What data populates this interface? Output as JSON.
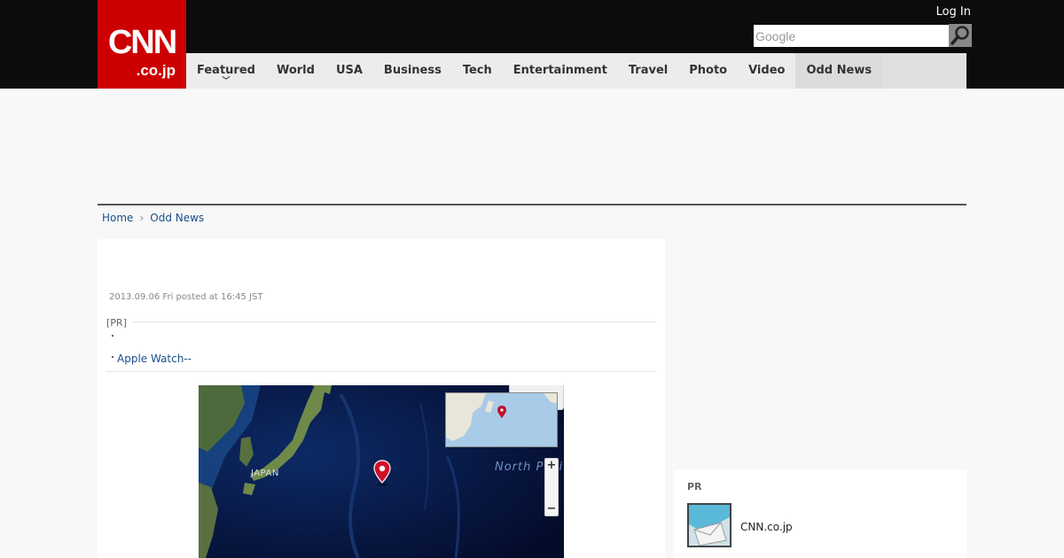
{
  "header": {
    "logo_main": "CNN",
    "logo_sub": ".co.jp",
    "login_label": "Log In",
    "search_placeholder": "Google",
    "colors": {
      "brand_red": "#cc0000",
      "bar_black": "#0c0c0c",
      "nav_bg": "#ececec"
    }
  },
  "nav": {
    "items": [
      {
        "label": "Featured",
        "has_dropdown": true
      },
      {
        "label": "World"
      },
      {
        "label": "USA"
      },
      {
        "label": "Business"
      },
      {
        "label": "Tech"
      },
      {
        "label": "Entertainment"
      },
      {
        "label": "Travel"
      },
      {
        "label": "Photo"
      },
      {
        "label": "Video"
      },
      {
        "label": "Odd News",
        "active": true
      }
    ],
    "dropdown_icon": "chevron-down-icon"
  },
  "breadcrumb": {
    "home": "Home",
    "separator_icon": "chevron-right-icon",
    "current": "Odd News"
  },
  "article": {
    "posted": "2013.09.06 Fri posted at 16:45 JST",
    "pr_label": "[PR]",
    "pr_links": [
      {
        "bullet": "・",
        "text": ""
      },
      {
        "bullet": "・",
        "text": "Apple Watch--"
      }
    ],
    "map": {
      "label_land": "JAPAN",
      "label_ocean": "North Pacific O",
      "zoom_in": "+",
      "zoom_out": "−",
      "marker_color": "#d0102a"
    }
  },
  "sidebar_pr": {
    "title": "PR",
    "items": [
      {
        "text": "CNN.co.jp"
      }
    ]
  }
}
